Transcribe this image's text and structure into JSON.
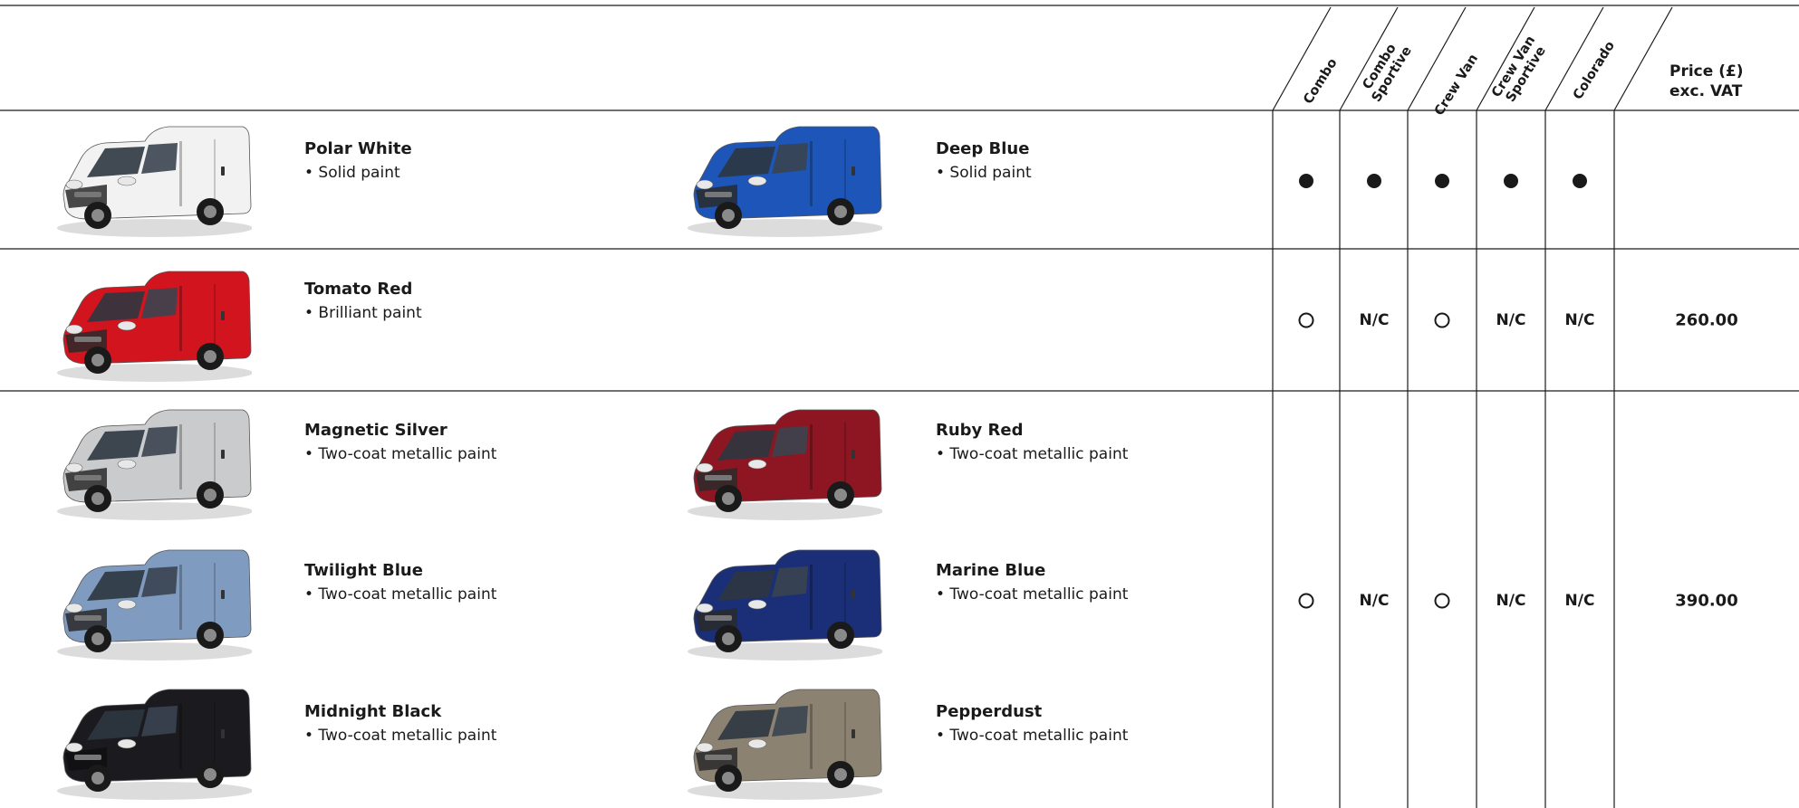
{
  "columns": {
    "combo": "Combo",
    "combo_sportive": [
      "Combo",
      "Sportive"
    ],
    "crew_van": "Crew Van",
    "crew_van_sportive": [
      "Crew Van",
      "Sportive"
    ],
    "colorado": "Colorado",
    "price": [
      "Price (£)",
      "exc. VAT"
    ]
  },
  "colours": [
    {
      "name": "Polar White",
      "finish": "• Solid paint",
      "paint_hex": "#f2f2f2"
    },
    {
      "name": "Deep Blue",
      "finish": "• Solid paint",
      "paint_hex": "#1d56b8"
    },
    {
      "name": "Tomato Red",
      "finish": "• Brilliant paint",
      "paint_hex": "#d2141e"
    },
    {
      "name": "Magnetic Silver",
      "finish": "• Two-coat metallic paint",
      "paint_hex": "#c9cbcd"
    },
    {
      "name": "Ruby Red",
      "finish": "• Two-coat metallic paint",
      "paint_hex": "#8e1622"
    },
    {
      "name": "Twilight Blue",
      "finish": "• Two-coat metallic paint",
      "paint_hex": "#7f9cc0"
    },
    {
      "name": "Marine Blue",
      "finish": "• Two-coat metallic paint",
      "paint_hex": "#1a2f78"
    },
    {
      "name": "Midnight Black",
      "finish": "• Two-coat metallic paint",
      "paint_hex": "#1b1b1f"
    },
    {
      "name": "Pepperdust",
      "finish": "• Two-coat metallic paint",
      "paint_hex": "#8c8272"
    }
  ],
  "availability_rows": [
    {
      "marks": [
        "standard",
        "standard",
        "standard",
        "standard",
        "standard"
      ],
      "price": ""
    },
    {
      "marks": [
        "option",
        "N/C",
        "option",
        "N/C",
        "N/C"
      ],
      "price": "260.00"
    },
    {
      "marks": [
        "option",
        "N/C",
        "option",
        "N/C",
        "N/C"
      ],
      "price": "390.00"
    }
  ]
}
